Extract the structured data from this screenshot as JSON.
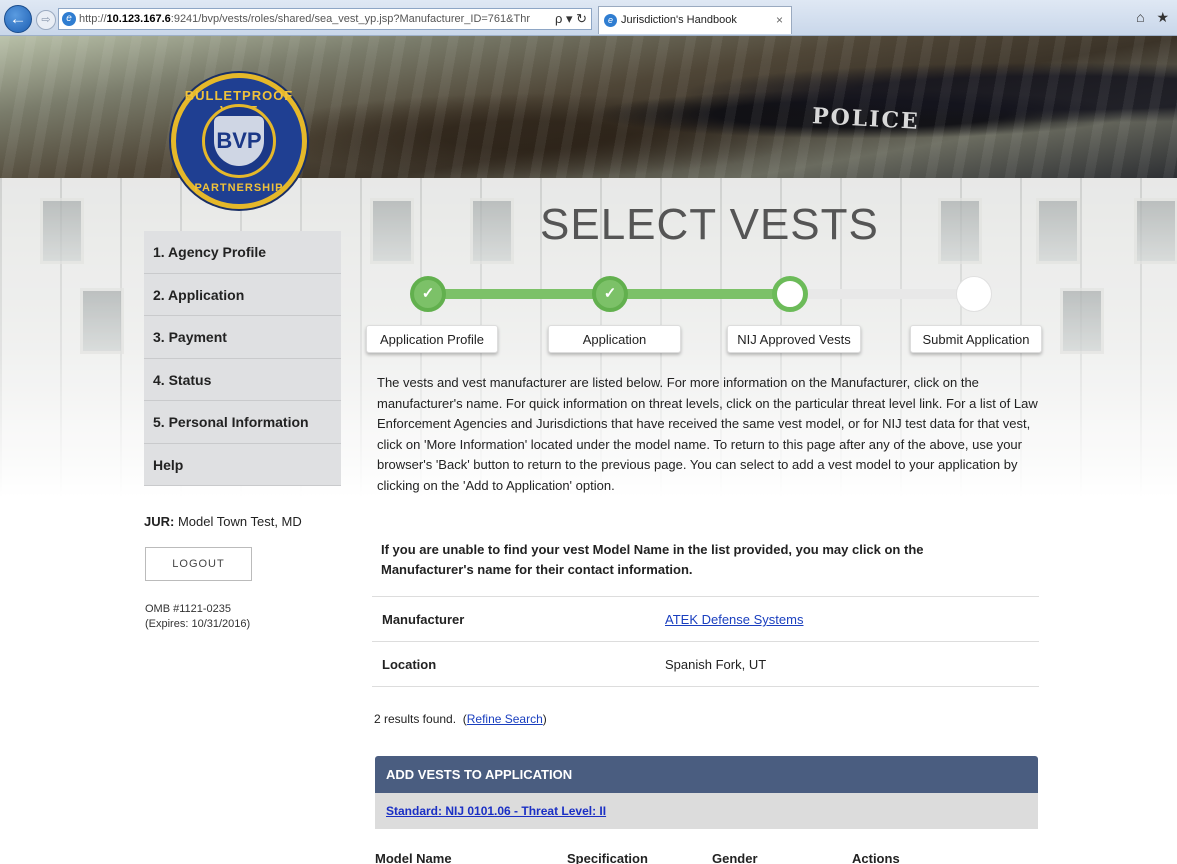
{
  "browser": {
    "url_prefix": "http://",
    "url_host": "10.123.167.6",
    "url_rest": ":9241/bvp/vests/roles/shared/sea_vest_yp.jsp?Manufacturer_ID=761&Thr",
    "tab_title": "Jurisdiction's Handbook",
    "nav_back": "←",
    "nav_forward": "⇨",
    "address_tools": "ρ ▾ ↻",
    "tab_close": "×",
    "right_icons": "⌂ ★"
  },
  "banner": {
    "text": "POLICE"
  },
  "logo": {
    "top": "BULLETPROOF VEST",
    "bottom": "PARTNERSHIP",
    "badge": "BVP"
  },
  "page_title": "SELECT VESTS",
  "sidebar": {
    "items": [
      {
        "label": "1. Agency Profile"
      },
      {
        "label": "2. Application"
      },
      {
        "label": "3. Payment"
      },
      {
        "label": "4. Status"
      },
      {
        "label": "5. Personal Information"
      },
      {
        "label": "Help"
      }
    ],
    "jur_label": "JUR:",
    "jur_value": "Model Town Test, MD",
    "logout": "LOGOUT",
    "omb_line1": "OMB #1121-0235",
    "omb_line2": "(Expires: 10/31/2016)"
  },
  "stepper": {
    "check": "✓",
    "steps": [
      {
        "label": "Application Profile",
        "state": "done"
      },
      {
        "label": "Application",
        "state": "done"
      },
      {
        "label": "NIJ Approved Vests",
        "state": "current"
      },
      {
        "label": "Submit Application",
        "state": "todo"
      }
    ],
    "colors": {
      "done": "#7cc168",
      "todo": "#e8e8e8"
    }
  },
  "intro": "The vests and vest manufacturer are listed below.  For more information on the Manufacturer, click on the manufacturer's name.  For quick information on threat levels, click on the particular threat level link.  For a list of Law Enforcement Agencies and Jurisdictions that have received the same vest model, or for NIJ test data for that vest, click on 'More Information' located under the model name.  To return to this page after any of the above, use your browser's 'Back' button to return to the previous page.  You can select to add a vest model to your application by clicking on the 'Add to Application' option.",
  "notice": "If you are unable to find your vest Model Name in the list provided, you may click on the Manufacturer's name for their contact information.",
  "manufacturer": {
    "label": "Manufacturer",
    "value": "ATEK Defense Systems"
  },
  "location": {
    "label": "Location",
    "value": "Spanish Fork, UT"
  },
  "results": {
    "text": "2 results found.",
    "open_paren": "(",
    "refine": "Refine Search",
    "close_paren": ")"
  },
  "panel": {
    "header": "ADD VESTS TO APPLICATION",
    "standard_link": "Standard: NIJ 0101.06 - Threat Level: II",
    "columns": [
      "Model Name",
      "Specification",
      "Gender",
      "Actions"
    ]
  }
}
